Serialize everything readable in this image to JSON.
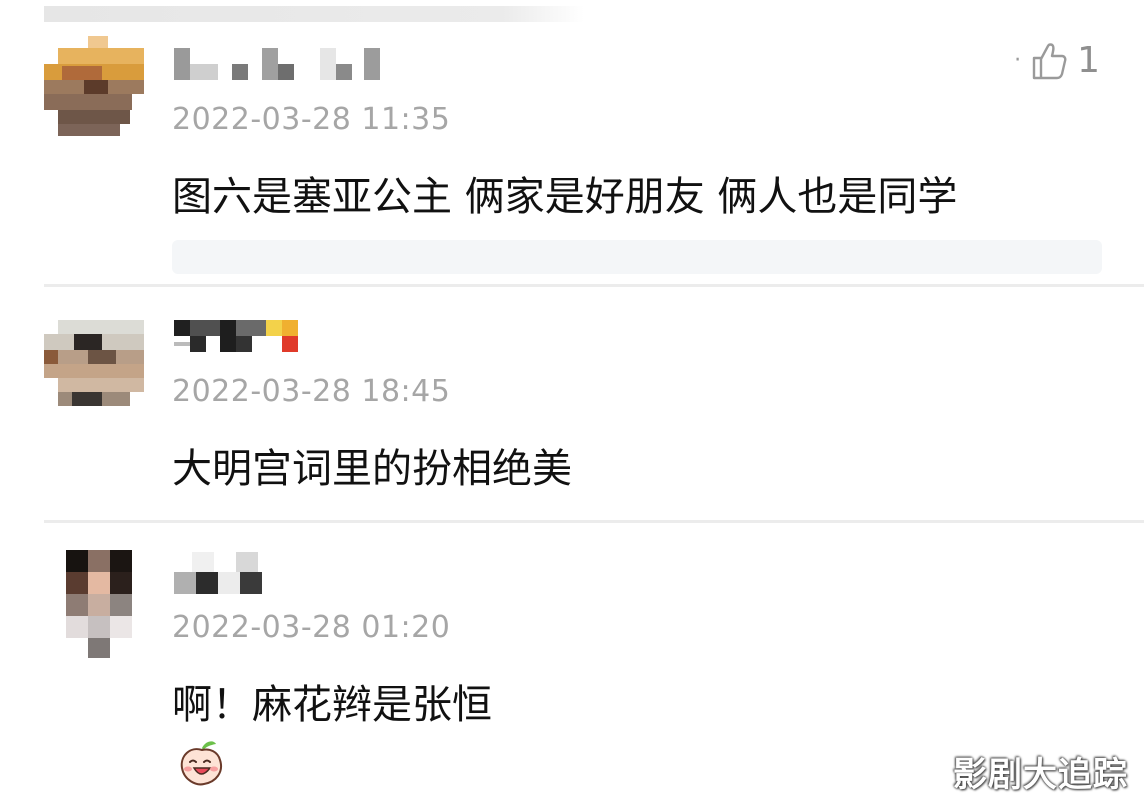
{
  "comments": [
    {
      "username": "",
      "timestamp": "2022-03-28 11:35",
      "text": "图六是塞亚公主 俩家是好朋友 俩人也是同学",
      "likes": "1"
    },
    {
      "username": "",
      "timestamp": "2022-03-28 18:45",
      "text": "大明宫词里的扮相绝美"
    },
    {
      "username": "",
      "timestamp": "2022-03-28 01:20",
      "text": "啊！麻花辫是张恒"
    }
  ],
  "watermark": "影剧大追踪",
  "icons": {
    "like": "thumbs-up-icon",
    "sticker": "peach-emoji-icon"
  }
}
